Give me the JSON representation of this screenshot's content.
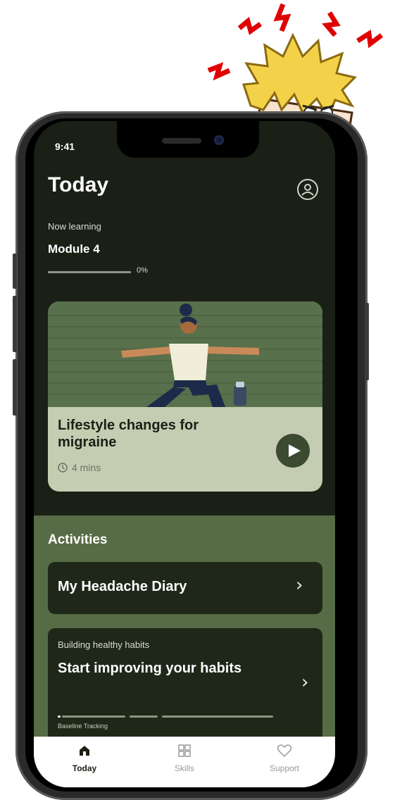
{
  "status": {
    "time": "9:41"
  },
  "header": {
    "title": "Today"
  },
  "now_learning": {
    "label": "Now learning",
    "module": "Module 4",
    "progress_text": "0%",
    "progress_fraction": 0
  },
  "lesson": {
    "title": "Lifestyle changes for migraine",
    "duration": "4 mins"
  },
  "activities": {
    "heading": "Activities",
    "items": [
      {
        "label": "My Headache Diary"
      },
      {
        "subtitle": "Building healthy habits",
        "label": "Start improving your habits",
        "track_label": "Baseline Tracking"
      }
    ]
  },
  "tabbar": {
    "tabs": [
      {
        "label": "Today"
      },
      {
        "label": "Skills"
      },
      {
        "label": "Support"
      }
    ]
  },
  "colors": {
    "screen_bg": "#1b2016",
    "card_bg": "#c4cdb1",
    "activities_bg": "#566b46",
    "activity_card": "#1f2818",
    "accent_dark": "#3b4a31"
  },
  "icons": {
    "profile": "profile-icon",
    "play": "play-icon",
    "clock": "clock-icon",
    "chevron": "chevron-right-icon",
    "home": "home-icon",
    "grid": "grid-icon",
    "heart": "heart-icon"
  }
}
